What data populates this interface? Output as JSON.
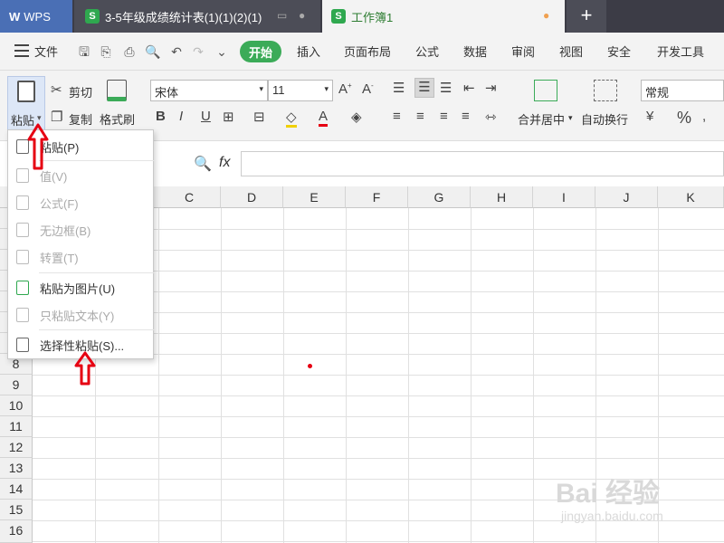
{
  "titlebar": {
    "wps_label": "WPS",
    "file1_name": "3-5年级成绩统计表(1)(1)(2)(1)",
    "file2_name": "工作簿1",
    "new_tab": "+"
  },
  "menubar": {
    "file_label": "文件",
    "tabs": [
      "开始",
      "插入",
      "页面布局",
      "公式",
      "数据",
      "审阅",
      "视图",
      "安全",
      "开发工具"
    ]
  },
  "ribbon": {
    "paste_label": "粘贴",
    "cut_label": "剪切",
    "copy_label": "复制",
    "format_painter_label": "格式刷",
    "font_name": "宋体",
    "font_size": "11",
    "merge_center_label": "合并居中",
    "auto_wrap_label": "自动换行",
    "number_format": "常规"
  },
  "formulabar": {
    "fx_label": "fx"
  },
  "grid": {
    "columns": [
      "C",
      "D",
      "E",
      "F",
      "G",
      "H",
      "I",
      "J",
      "K"
    ],
    "rows": [
      "8",
      "9",
      "10",
      "11",
      "12",
      "13",
      "14",
      "15",
      "16"
    ]
  },
  "dropdown": {
    "items": [
      {
        "label": "粘贴(P)",
        "enabled": true
      },
      {
        "label": "值(V)",
        "enabled": false
      },
      {
        "label": "公式(F)",
        "enabled": false
      },
      {
        "label": "无边框(B)",
        "enabled": false
      },
      {
        "label": "转置(T)",
        "enabled": false
      },
      {
        "label": "粘贴为图片(U)",
        "enabled": true
      },
      {
        "label": "只粘贴文本(Y)",
        "enabled": false
      },
      {
        "label": "选择性粘贴(S)...",
        "enabled": true
      }
    ]
  },
  "watermark": {
    "text": "Bai 经验",
    "url": "jingyan.baidu.com"
  },
  "colors": {
    "accent_green": "#3bab58",
    "arrow_red": "#e60012",
    "titlebar": "#3c3c46"
  }
}
